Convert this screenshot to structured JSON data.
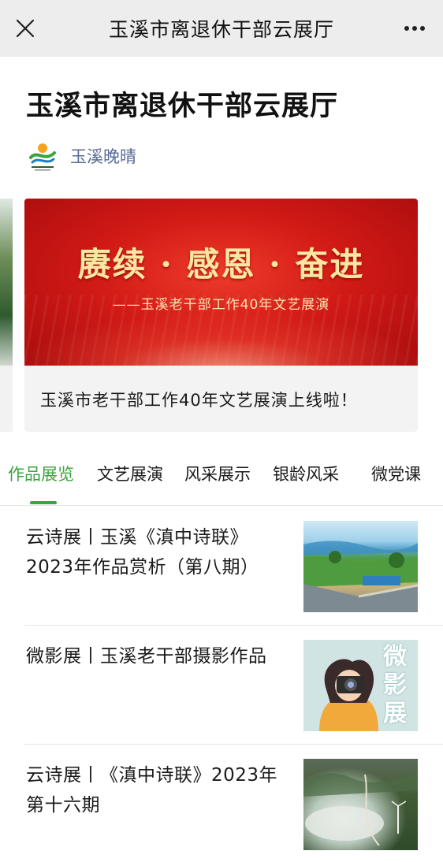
{
  "topbar": {
    "title": "玉溪市离退休干部云展厅"
  },
  "article": {
    "title": "玉溪市离退休干部云展厅",
    "account_name": "玉溪晚晴"
  },
  "featured": {
    "banner_headline": "赓续 · 感恩 · 奋进",
    "banner_sub": "——玉溪老干部工作40年文艺展演",
    "caption": "玉溪市老干部工作40年文艺展演上线啦！"
  },
  "tabs": [
    {
      "label": "作品展览",
      "active": true
    },
    {
      "label": "文艺展演",
      "active": false
    },
    {
      "label": "风采展示",
      "active": false
    },
    {
      "label": "银龄风采",
      "active": false
    },
    {
      "label": "微党课",
      "active": false
    }
  ],
  "list": [
    {
      "title": "云诗展丨玉溪《滇中诗联》2023年作品赏析（第八期）"
    },
    {
      "title": "微影展丨玉溪老干部摄影作品",
      "thumb_text": "微影展"
    },
    {
      "title": "云诗展丨《滇中诗联》2023年第十六期"
    }
  ],
  "colors": {
    "accent_green": "#3aa43f",
    "account_blue": "#576b95",
    "topbar_bg": "#ededed",
    "banner_red": "#d21a16",
    "banner_gold": "#fbe7a2"
  },
  "icons": {
    "close": "close-icon",
    "more": "more-dots-icon",
    "logo": "account-logo-icon"
  }
}
